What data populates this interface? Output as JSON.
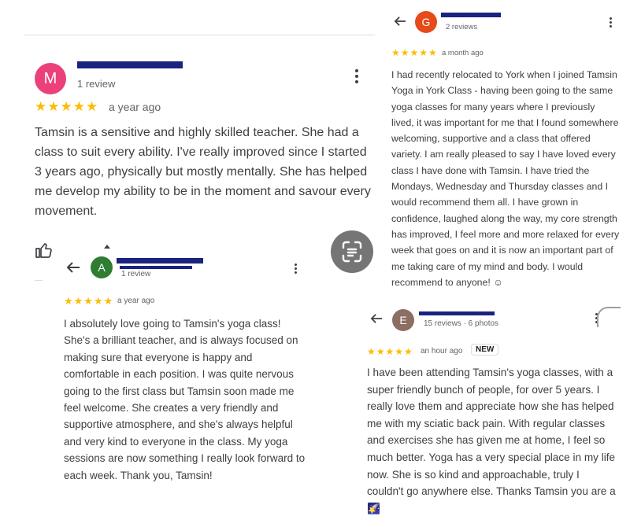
{
  "review1": {
    "avatar_letter": "M",
    "avatar_color": "#ec407a",
    "meta": "1 review",
    "stars": "★★★★★",
    "time": "a year ago",
    "text": "Tamsin is a sensitive and highly skilled teacher. She had a class to suit every ability. I've really improved since I started 3 years ago, physically but mostly mentally. She has helped me develop my ability to be in the moment and savour every movement."
  },
  "review2": {
    "avatar_letter": "A",
    "avatar_color": "#2e7d32",
    "meta": "1 review",
    "stars": "★★★★★",
    "time": "a year ago",
    "text": "I absolutely love going to Tamsin's yoga class! She's a brilliant teacher, and is always focused on making sure that everyone is happy and comfortable in each position. I was quite nervous going to the first class but Tamsin soon made me feel welcome. She creates a very friendly and supportive atmosphere, and she's always helpful and very kind to everyone in the class. My yoga sessions are now something I really look forward to each week. Thank you, Tamsin!"
  },
  "review3": {
    "avatar_letter": "G",
    "avatar_color": "#e64a19",
    "meta": "2 reviews",
    "stars": "★★★★★",
    "time": "a month ago",
    "text": "I had recently relocated to York when I joined Tamsin Yoga in York Class - having been going to the same yoga classes for many years where I previously lived, it was important for me that I found somewhere welcoming, supportive and a class that offered variety. I am really pleased to say I have loved every class I have done with Tamsin. I have tried the Mondays, Wednesday and Thursday classes and I would recommend them all. I have grown in confidence, laughed along the way, my core strength has improved, I feel more and more relaxed for every week that goes on and it is now an important part of me taking care of my mind and body. I would recommend to anyone! ☺"
  },
  "review4": {
    "avatar_letter": "E",
    "avatar_color": "#8d6e63",
    "meta": "15 reviews · 6 photos",
    "stars": "★★★★★",
    "time": "an hour ago",
    "badge": "NEW",
    "text": "I have been attending Tamsin's yoga classes, with a super friendly bunch of people, for over 5 years. I really love them and appreciate how she has helped me with my sciatic back pain. With regular classes and exercises she has given me at home, I feel so much better. Yoga has a very special place in my life now. She is so kind and approachable, truly I couldn't go anywhere else. Thanks Tamsin you are a 🌠"
  },
  "icons": {
    "like": "thumbs-up-icon",
    "lens": "lens-scan-icon",
    "back": "back-arrow-icon",
    "more": "more-vert-icon"
  }
}
